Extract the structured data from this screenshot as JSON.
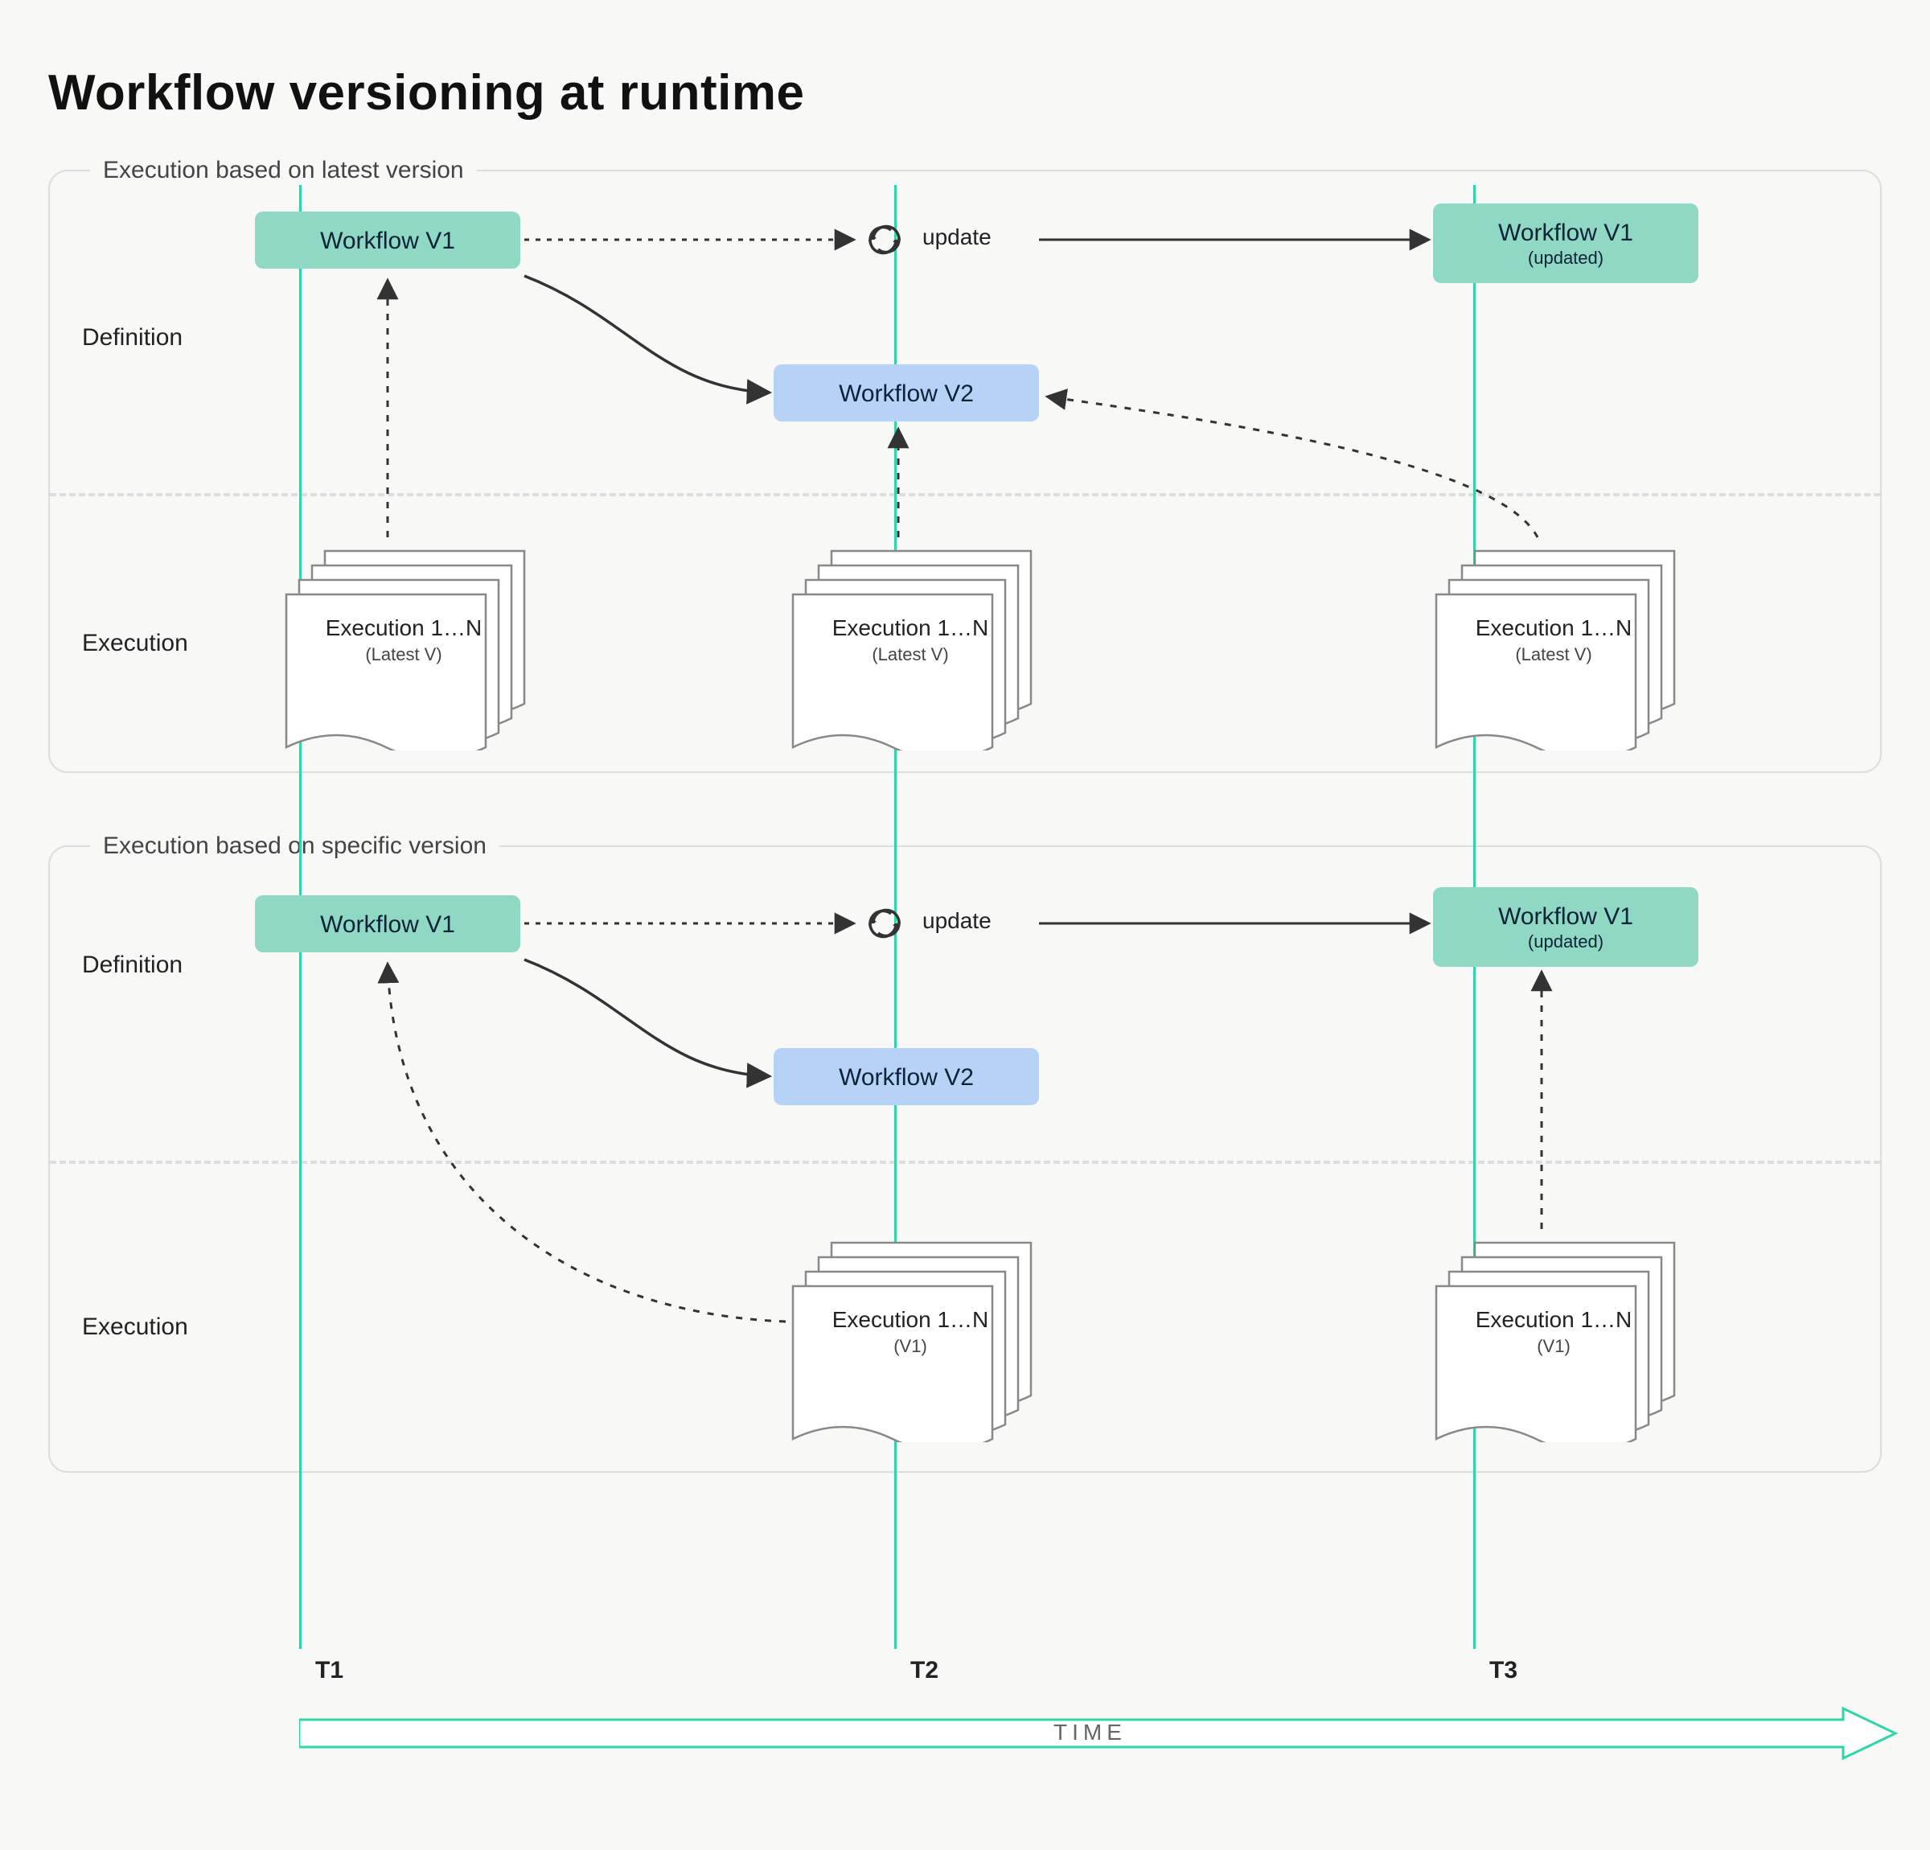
{
  "title": "Workflow versioning at runtime",
  "panels": {
    "latest": {
      "label": "Execution based on latest version",
      "rows": {
        "definition": "Definition",
        "execution": "Execution"
      },
      "boxes": {
        "v1": {
          "title": "Workflow V1",
          "sub": ""
        },
        "v2": {
          "title": "Workflow V2",
          "sub": ""
        },
        "v1upd": {
          "title": "Workflow V1",
          "sub": "(updated)"
        }
      },
      "executions": {
        "e1": {
          "title": "Execution 1…N",
          "sub": "(Latest V)"
        },
        "e2": {
          "title": "Execution 1…N",
          "sub": "(Latest V)"
        },
        "e3": {
          "title": "Execution 1…N",
          "sub": "(Latest V)"
        }
      },
      "update_label": "update"
    },
    "specific": {
      "label": "Execution based on specific version",
      "rows": {
        "definition": "Definition",
        "execution": "Execution"
      },
      "boxes": {
        "v1": {
          "title": "Workflow V1",
          "sub": ""
        },
        "v2": {
          "title": "Workflow V2",
          "sub": ""
        },
        "v1upd": {
          "title": "Workflow V1",
          "sub": "(updated)"
        }
      },
      "executions": {
        "e1": {
          "title": "Execution 1…N",
          "sub": "(V1)"
        },
        "e2": {
          "title": "Execution 1…N",
          "sub": "(V1)"
        }
      },
      "update_label": "update"
    }
  },
  "timeline": {
    "t1": "T1",
    "t2": "T2",
    "t3": "T3",
    "axis": "TIME"
  },
  "icons": {
    "refresh": "refresh-icon"
  },
  "colors": {
    "accent": "#8fd9c4",
    "accent2": "#b7d2f7",
    "line_green": "#2fd4a7",
    "arrow": "#333"
  }
}
